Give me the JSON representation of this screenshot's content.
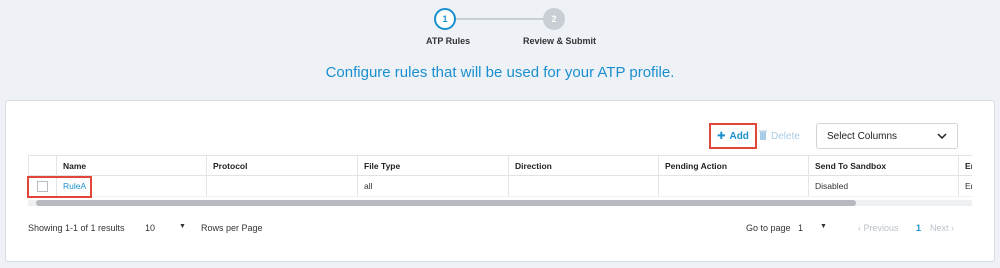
{
  "stepper": {
    "steps": [
      {
        "number": "1",
        "label": "ATP Rules"
      },
      {
        "number": "2",
        "label": "Review & Submit"
      }
    ]
  },
  "headline": "Configure rules that will be used for your ATP profile.",
  "toolbar": {
    "add_label": "Add",
    "delete_label": "Delete",
    "select_columns_label": "Select Columns"
  },
  "table": {
    "columns": [
      "Name",
      "Protocol",
      "File Type",
      "Direction",
      "Pending Action",
      "Send To Sandbox",
      "En"
    ],
    "rows": [
      {
        "name": "RuleA",
        "protocol": "",
        "file_type": "all",
        "direction": "",
        "pending_action": "",
        "send_to_sandbox": "Disabled",
        "en": "En"
      }
    ]
  },
  "pagination": {
    "results_text": "Showing 1-1 of 1 results",
    "page_size": "10",
    "rows_per_page_label": "Rows per Page",
    "go_to_page_label": "Go to page",
    "go_to_page_value": "1",
    "previous_label": "Previous",
    "current_page": "1",
    "next_label": "Next"
  },
  "colors": {
    "accent": "#1a8fcf",
    "highlight": "#e0473a",
    "disabled": "#a9cde6"
  }
}
